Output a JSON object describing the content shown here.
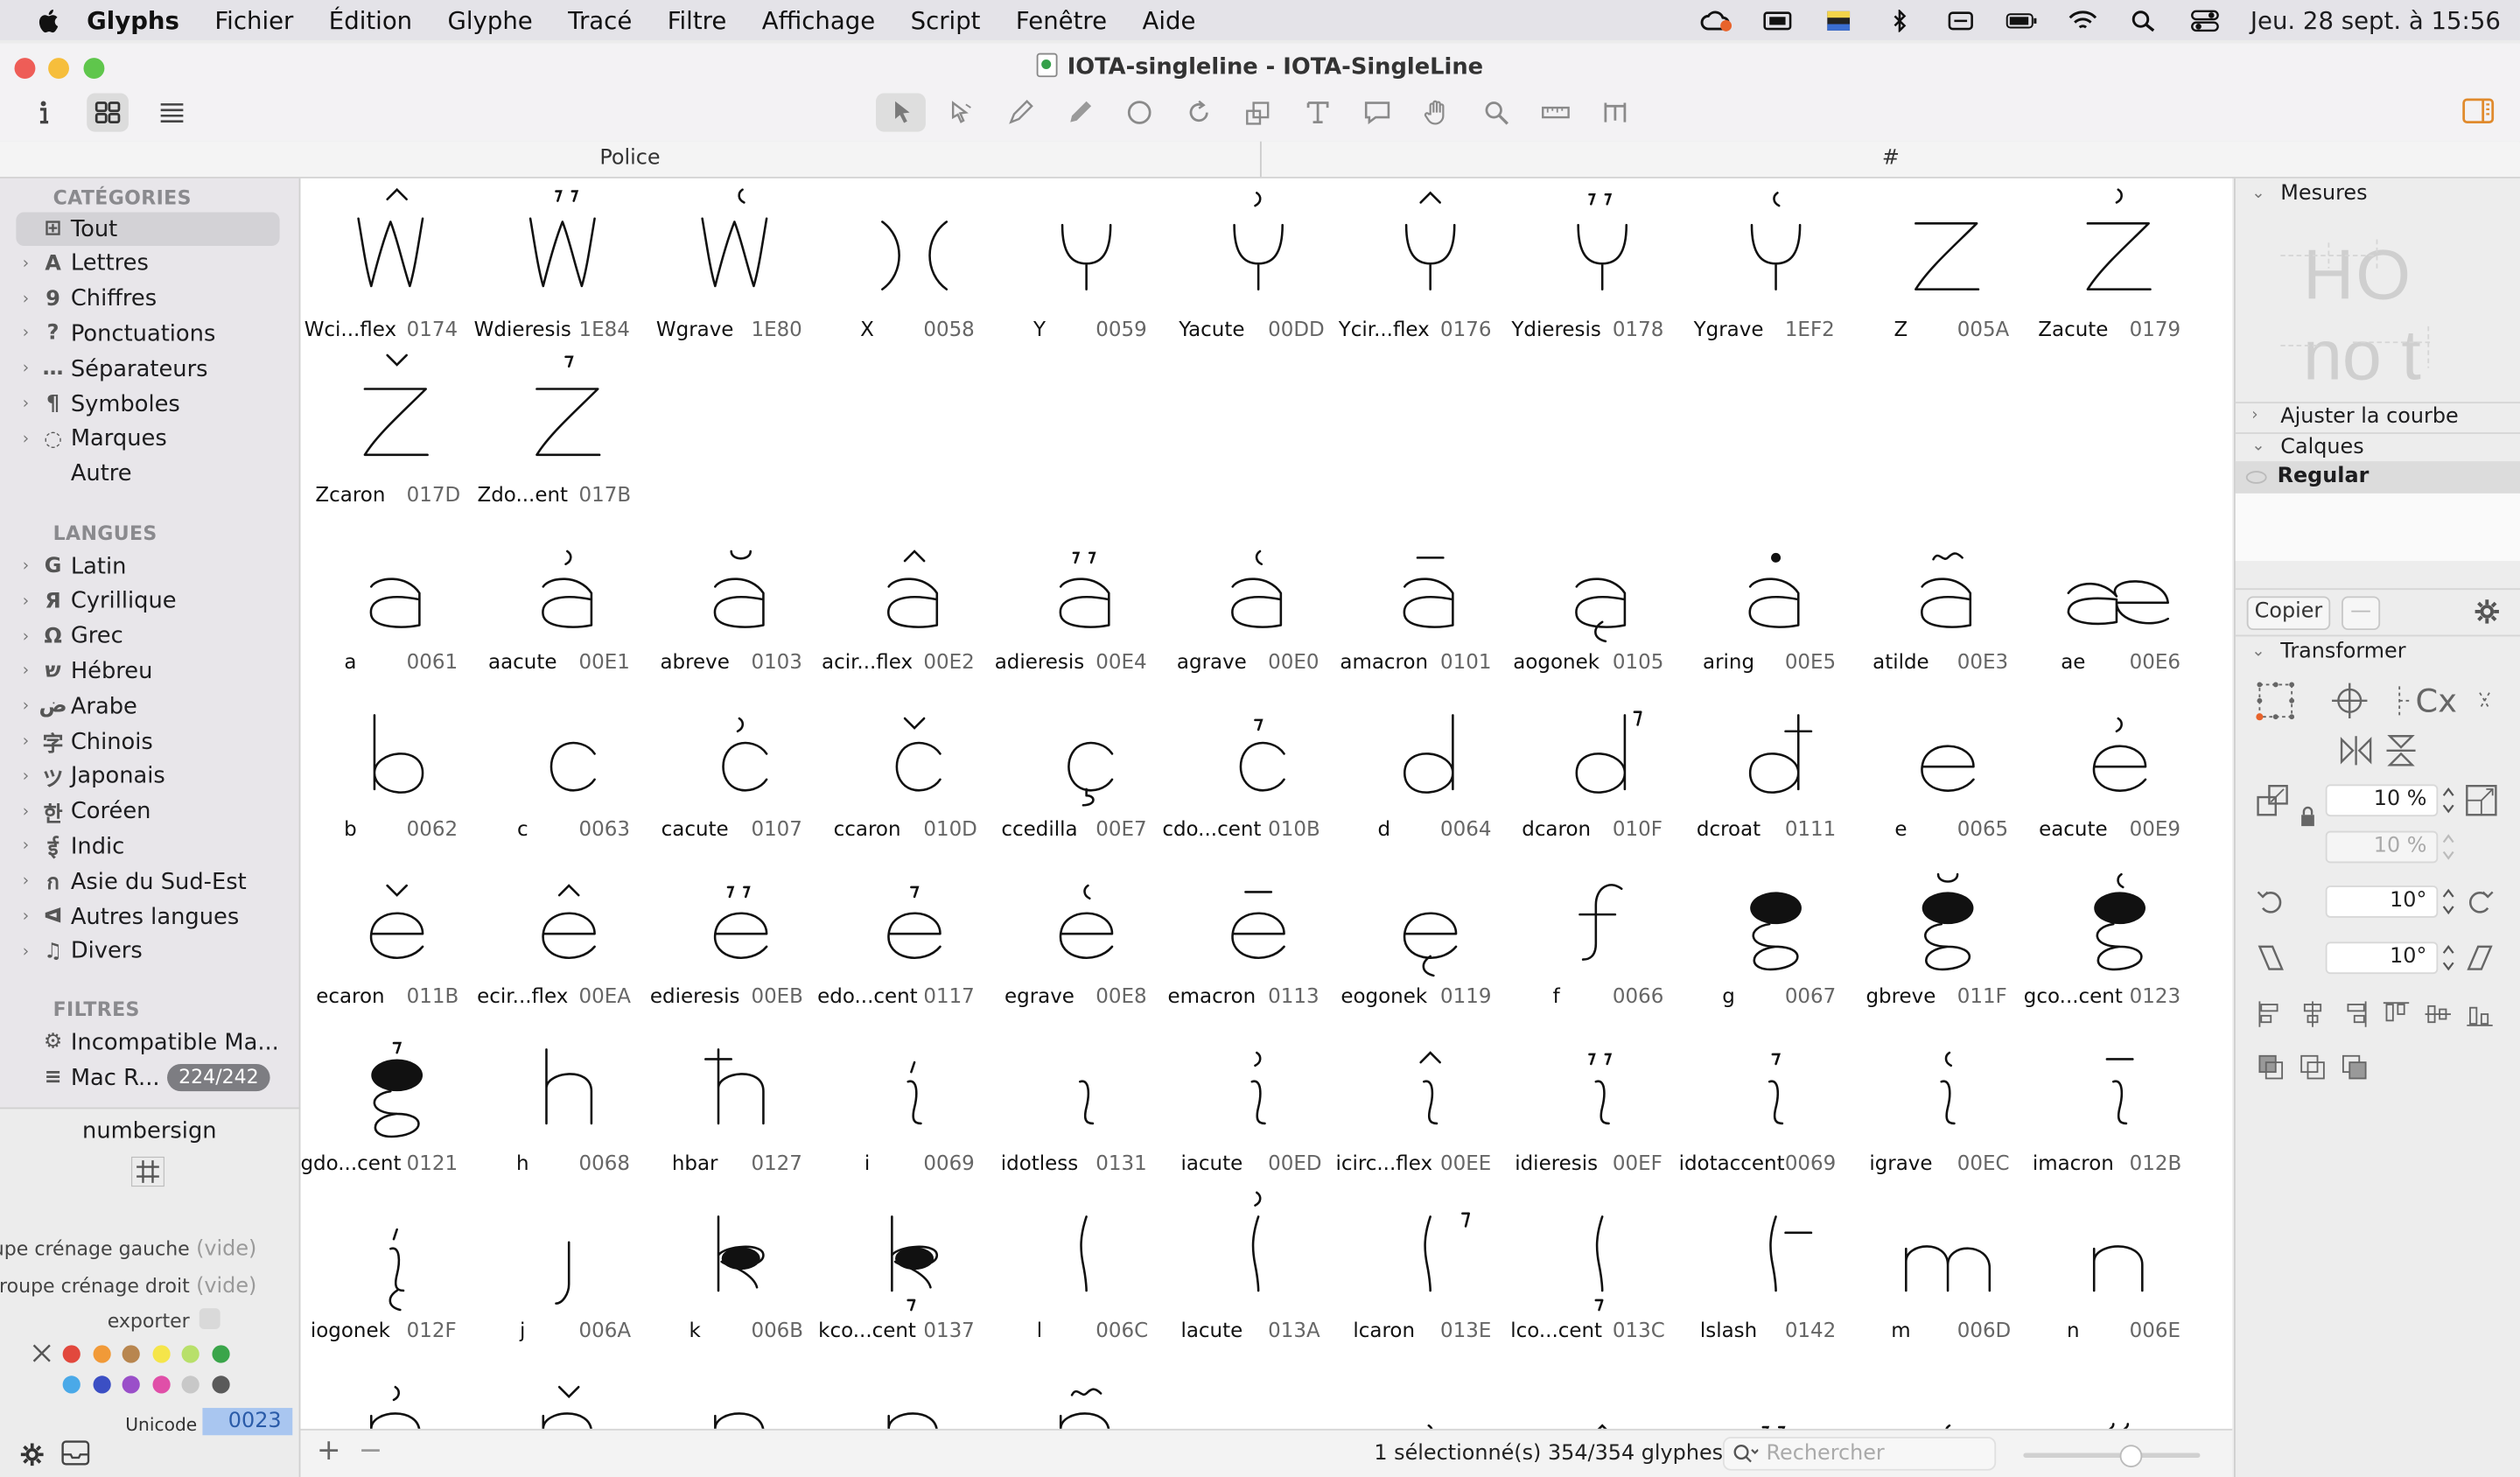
{
  "menubar": {
    "app": "Glyphs",
    "items": [
      "Fichier",
      "Édition",
      "Glyphe",
      "Tracé",
      "Filtre",
      "Affichage",
      "Script",
      "Fenêtre",
      "Aide"
    ],
    "clock": "Jeu. 28 sept. à  15:56"
  },
  "window": {
    "title": "IOTA-singleline - IOTA-SingleLine",
    "tabs": [
      "Police",
      "#"
    ]
  },
  "sidebar": {
    "categories_header": "CATÉGORIES",
    "categories": [
      {
        "label": "Tout",
        "icon": "grid-icon"
      },
      {
        "label": "Lettres",
        "icon": "letter-a-icon"
      },
      {
        "label": "Chiffres",
        "icon": "digit-icon"
      },
      {
        "label": "Ponctuations",
        "icon": "question-icon"
      },
      {
        "label": "Séparateurs",
        "icon": "separator-icon"
      },
      {
        "label": "Symboles",
        "icon": "pilcrow-icon"
      },
      {
        "label": "Marques",
        "icon": "mark-icon"
      },
      {
        "label": "Autre",
        "icon": ""
      }
    ],
    "languages_header": "LANGUES",
    "languages": [
      {
        "label": "Latin",
        "icon": "G"
      },
      {
        "label": "Cyrillique",
        "icon": "Я"
      },
      {
        "label": "Grec",
        "icon": "Ω"
      },
      {
        "label": "Hébreu",
        "icon": "ש"
      },
      {
        "label": "Arabe",
        "icon": "ض"
      },
      {
        "label": "Chinois",
        "icon": "字"
      },
      {
        "label": "Japonais",
        "icon": "ツ"
      },
      {
        "label": "Coréen",
        "icon": "한"
      },
      {
        "label": "Indic",
        "icon": "ई"
      },
      {
        "label": "Asie du Sud-Est",
        "icon": "ก"
      },
      {
        "label": "Autres langues",
        "icon": "ᐊ"
      },
      {
        "label": "Divers",
        "icon": "♫"
      }
    ],
    "filters_header": "FILTRES",
    "filters": [
      {
        "label": "Incompatible Ma...",
        "icon": "gear-icon",
        "badge": ""
      },
      {
        "label": "Mac R...",
        "icon": "list-icon",
        "badge": "224/242"
      }
    ]
  },
  "info": {
    "glyph_name": "numbersign",
    "kern_left_label": "groupe crénage gauche",
    "kern_left_value": "(vide)",
    "kern_right_label": "groupe crénage droit",
    "kern_right_value": "(vide)",
    "export_label": "exporter",
    "unicode_label": "Unicode",
    "unicode_value": "0023",
    "colors": [
      "#e2483d",
      "#f19a38",
      "#b8864f",
      "#f5e54a",
      "#b8e06a",
      "#3aa54a",
      "#4aa9e8",
      "#3b4fc4",
      "#9a4fc9",
      "#e04fa8",
      "#c8c8c8",
      "#5a5a5a"
    ]
  },
  "glyph_rows": [
    [
      {
        "name": "Wci...flex",
        "code": "0174",
        "shape": "W",
        "accent": "circumflex"
      },
      {
        "name": "Wdieresis",
        "code": "1E84",
        "shape": "W",
        "accent": "dieresis"
      },
      {
        "name": "Wgrave",
        "code": "1E80",
        "shape": "W",
        "accent": "grave"
      },
      {
        "name": "X",
        "code": "0058",
        "shape": "X",
        "accent": ""
      },
      {
        "name": "Y",
        "code": "0059",
        "shape": "Y",
        "accent": ""
      },
      {
        "name": "Yacute",
        "code": "00DD",
        "shape": "Y",
        "accent": "acute"
      },
      {
        "name": "Ycir...flex",
        "code": "0176",
        "shape": "Y",
        "accent": "circumflex"
      },
      {
        "name": "Ydieresis",
        "code": "0178",
        "shape": "Y",
        "accent": "dieresis"
      },
      {
        "name": "Ygrave",
        "code": "1EF2",
        "shape": "Y",
        "accent": "grave"
      },
      {
        "name": "Z",
        "code": "005A",
        "shape": "Z",
        "accent": ""
      },
      {
        "name": "Zacute",
        "code": "0179",
        "shape": "Z",
        "accent": "acute"
      }
    ],
    [
      {
        "name": "Zcaron",
        "code": "017D",
        "shape": "Z",
        "accent": "caron"
      },
      {
        "name": "Zdo...ent",
        "code": "017B",
        "shape": "Z",
        "accent": "dot"
      }
    ],
    [
      {
        "name": "a",
        "code": "0061",
        "shape": "a",
        "accent": ""
      },
      {
        "name": "aacute",
        "code": "00E1",
        "shape": "a",
        "accent": "acute"
      },
      {
        "name": "abreve",
        "code": "0103",
        "shape": "a",
        "accent": "breve"
      },
      {
        "name": "acir...flex",
        "code": "00E2",
        "shape": "a",
        "accent": "circumflex"
      },
      {
        "name": "adieresis",
        "code": "00E4",
        "shape": "a",
        "accent": "dieresis"
      },
      {
        "name": "agrave",
        "code": "00E0",
        "shape": "a",
        "accent": "grave"
      },
      {
        "name": "amacron",
        "code": "0101",
        "shape": "a",
        "accent": "macron"
      },
      {
        "name": "aogonek",
        "code": "0105",
        "shape": "a",
        "accent": "ogonek"
      },
      {
        "name": "aring",
        "code": "00E5",
        "shape": "a",
        "accent": "ring"
      },
      {
        "name": "atilde",
        "code": "00E3",
        "shape": "a",
        "accent": "tilde"
      },
      {
        "name": "ae",
        "code": "00E6",
        "shape": "ae",
        "accent": ""
      }
    ],
    [
      {
        "name": "b",
        "code": "0062",
        "shape": "b",
        "accent": ""
      },
      {
        "name": "c",
        "code": "0063",
        "shape": "c",
        "accent": ""
      },
      {
        "name": "cacute",
        "code": "0107",
        "shape": "c",
        "accent": "acute"
      },
      {
        "name": "ccaron",
        "code": "010D",
        "shape": "c",
        "accent": "caron"
      },
      {
        "name": "ccedilla",
        "code": "00E7",
        "shape": "c",
        "accent": "cedilla"
      },
      {
        "name": "cdo...cent",
        "code": "010B",
        "shape": "c",
        "accent": "dot"
      },
      {
        "name": "d",
        "code": "0064",
        "shape": "d",
        "accent": ""
      },
      {
        "name": "dcaron",
        "code": "010F",
        "shape": "d",
        "accent": "caronside"
      },
      {
        "name": "dcroat",
        "code": "0111",
        "shape": "d",
        "accent": "stroke"
      },
      {
        "name": "e",
        "code": "0065",
        "shape": "e",
        "accent": ""
      },
      {
        "name": "eacute",
        "code": "00E9",
        "shape": "e",
        "accent": "acute"
      }
    ],
    [
      {
        "name": "ecaron",
        "code": "011B",
        "shape": "e",
        "accent": "caron"
      },
      {
        "name": "ecir...flex",
        "code": "00EA",
        "shape": "e",
        "accent": "circumflex"
      },
      {
        "name": "edieresis",
        "code": "00EB",
        "shape": "e",
        "accent": "dieresis"
      },
      {
        "name": "edo...cent",
        "code": "0117",
        "shape": "e",
        "accent": "dot"
      },
      {
        "name": "egrave",
        "code": "00E8",
        "shape": "e",
        "accent": "grave"
      },
      {
        "name": "emacron",
        "code": "0113",
        "shape": "e",
        "accent": "macron"
      },
      {
        "name": "eogonek",
        "code": "0119",
        "shape": "e",
        "accent": "ogonek"
      },
      {
        "name": "f",
        "code": "0066",
        "shape": "f",
        "accent": ""
      },
      {
        "name": "g",
        "code": "0067",
        "shape": "g",
        "accent": ""
      },
      {
        "name": "gbreve",
        "code": "011F",
        "shape": "g",
        "accent": "breve"
      },
      {
        "name": "gco...cent",
        "code": "0123",
        "shape": "g",
        "accent": "grave"
      }
    ],
    [
      {
        "name": "gdo...cent",
        "code": "0121",
        "shape": "g",
        "accent": "dot"
      },
      {
        "name": "h",
        "code": "0068",
        "shape": "h",
        "accent": ""
      },
      {
        "name": "hbar",
        "code": "0127",
        "shape": "h",
        "accent": "stroke"
      },
      {
        "name": "i",
        "code": "0069",
        "shape": "i",
        "accent": "dot"
      },
      {
        "name": "idotless",
        "code": "0131",
        "shape": "i",
        "accent": ""
      },
      {
        "name": "iacute",
        "code": "00ED",
        "shape": "i",
        "accent": "acute"
      },
      {
        "name": "icirc...flex",
        "code": "00EE",
        "shape": "i",
        "accent": "circumflex"
      },
      {
        "name": "idieresis",
        "code": "00EF",
        "shape": "i",
        "accent": "dieresis"
      },
      {
        "name": "idotaccent",
        "code": "0069",
        "shape": "i",
        "accent": "dot"
      },
      {
        "name": "igrave",
        "code": "00EC",
        "shape": "i",
        "accent": "grave"
      },
      {
        "name": "imacron",
        "code": "012B",
        "shape": "i",
        "accent": "macron"
      }
    ],
    [
      {
        "name": "iogonek",
        "code": "012F",
        "shape": "i",
        "accent": "ogonek"
      },
      {
        "name": "j",
        "code": "006A",
        "shape": "j",
        "accent": ""
      },
      {
        "name": "k",
        "code": "006B",
        "shape": "k",
        "accent": ""
      },
      {
        "name": "kco...cent",
        "code": "0137",
        "shape": "k",
        "accent": "below"
      },
      {
        "name": "l",
        "code": "006C",
        "shape": "l",
        "accent": ""
      },
      {
        "name": "lacute",
        "code": "013A",
        "shape": "l",
        "accent": "acute"
      },
      {
        "name": "lcaron",
        "code": "013E",
        "shape": "l",
        "accent": "caronside"
      },
      {
        "name": "lco...cent",
        "code": "013C",
        "shape": "l",
        "accent": "below"
      },
      {
        "name": "lslash",
        "code": "0142",
        "shape": "l",
        "accent": "stroke"
      },
      {
        "name": "m",
        "code": "006D",
        "shape": "m",
        "accent": ""
      },
      {
        "name": "n",
        "code": "006E",
        "shape": "n",
        "accent": ""
      }
    ],
    [
      {
        "name": "",
        "code": "",
        "shape": "n",
        "accent": "acute"
      },
      {
        "name": "",
        "code": "",
        "shape": "n",
        "accent": "caron"
      },
      {
        "name": "",
        "code": "",
        "shape": "n",
        "accent": ""
      },
      {
        "name": "",
        "code": "",
        "shape": "n",
        "accent": ""
      },
      {
        "name": "",
        "code": "",
        "shape": "n",
        "accent": "tilde"
      },
      {
        "name": "",
        "code": "",
        "shape": "o",
        "accent": ""
      },
      {
        "name": "",
        "code": "",
        "shape": "o",
        "accent": "acute"
      },
      {
        "name": "",
        "code": "",
        "shape": "o",
        "accent": "circumflex"
      },
      {
        "name": "",
        "code": "",
        "shape": "o",
        "accent": "dieresis"
      },
      {
        "name": "",
        "code": "",
        "shape": "o",
        "accent": "grave"
      },
      {
        "name": "",
        "code": "",
        "shape": "o",
        "accent": "hungarum"
      }
    ]
  ],
  "statusbar": {
    "status": "1 sélectionné(s) 354/354 glyphes",
    "search_placeholder": "Rechercher",
    "zoom_fraction": 0.6
  },
  "rightpanel": {
    "mesures": "Mesures",
    "preview_line1": "HO",
    "preview_line2": "no t",
    "ajuster": "Ajuster la courbe",
    "calques": "Calques",
    "layer": "Regular",
    "copier": "Copier",
    "transformer": "Transformer",
    "scale_x": "10 %",
    "scale_y": "10 %",
    "rotate": "10°",
    "slant": "10°"
  }
}
